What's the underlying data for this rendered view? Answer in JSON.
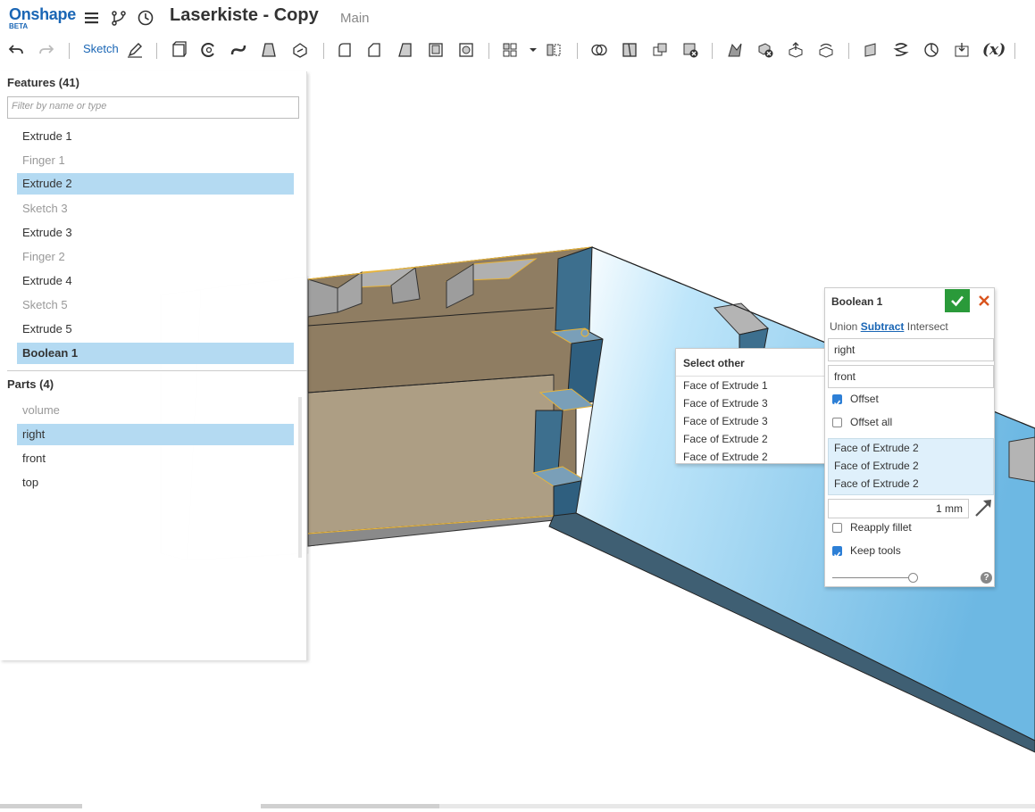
{
  "app": {
    "logo_text": "Onshape",
    "logo_badge": "BETA",
    "document_title": "Laserkiste - Copy",
    "branch": "Main"
  },
  "topbar_icons": [
    "menu-icon",
    "branch-icon",
    "history-icon"
  ],
  "toolbar": {
    "sketch_label": "Sketch",
    "variable_label": "(x)",
    "icons": [
      "undo-icon",
      "redo-icon",
      "sketch-pencil-icon",
      "extrude-icon",
      "revolve-icon",
      "sweep-icon",
      "loft-icon",
      "thicken-icon",
      "fillet-icon",
      "chamfer-icon",
      "draft-icon",
      "shell-icon",
      "hole-icon",
      "pattern-icon",
      "mirror-icon",
      "boolean-icon",
      "split-icon",
      "transform-icon",
      "delete-part-icon",
      "modify-fillet-icon",
      "delete-face-icon",
      "move-face-icon",
      "replace-face-icon",
      "plane-icon",
      "helix-icon",
      "mate-connector-icon",
      "import-icon"
    ]
  },
  "feature_panel": {
    "features_heading": "Features (41)",
    "filter_placeholder": "Filter by name or type",
    "features": [
      {
        "label": "Extrude 1",
        "state": "normal"
      },
      {
        "label": "Finger 1",
        "state": "dim"
      },
      {
        "label": "Extrude 2",
        "state": "selected"
      },
      {
        "label": "Sketch 3",
        "state": "dim"
      },
      {
        "label": "Extrude 3",
        "state": "normal"
      },
      {
        "label": "Finger 2",
        "state": "dim"
      },
      {
        "label": "Extrude 4",
        "state": "normal"
      },
      {
        "label": "Sketch 5",
        "state": "dim"
      },
      {
        "label": "Extrude 5",
        "state": "normal"
      },
      {
        "label": "Boolean 1",
        "state": "selected-bold"
      }
    ],
    "parts_heading": "Parts (4)",
    "parts": [
      {
        "label": "volume",
        "state": "dim"
      },
      {
        "label": "right",
        "state": "selected"
      },
      {
        "label": "front",
        "state": "normal"
      },
      {
        "label": "top",
        "state": "normal"
      }
    ]
  },
  "select_other": {
    "title": "Select other",
    "items": [
      "Face of Extrude 1",
      "Face of Extrude 3",
      "Face of Extrude 3",
      "Face of Extrude 2",
      "Face of Extrude 2"
    ]
  },
  "boolean_dialog": {
    "title": "Boolean 1",
    "operations": [
      "Union",
      "Subtract",
      "Intersect"
    ],
    "active_operation": "Subtract",
    "tools_field": "right",
    "targets_field": "front",
    "offset_label": "Offset",
    "offset_checked": true,
    "offset_all_label": "Offset all",
    "offset_all_checked": false,
    "offset_faces": [
      "Face of Extrude 2",
      "Face of Extrude 2",
      "Face of Extrude 2"
    ],
    "offset_distance": "1 mm",
    "reapply_fillet_label": "Reapply fillet",
    "reapply_fillet_checked": false,
    "keep_tools_label": "Keep tools",
    "keep_tools_checked": true,
    "help_label": "?"
  },
  "colors": {
    "brand_blue": "#1a66b5",
    "selection_blue": "#b4daf2",
    "part_blue": "#7cc3e8",
    "confirm_green": "#2a9a3a",
    "cancel_red": "#d9541e",
    "edge_highlight": "#e8b43a"
  }
}
